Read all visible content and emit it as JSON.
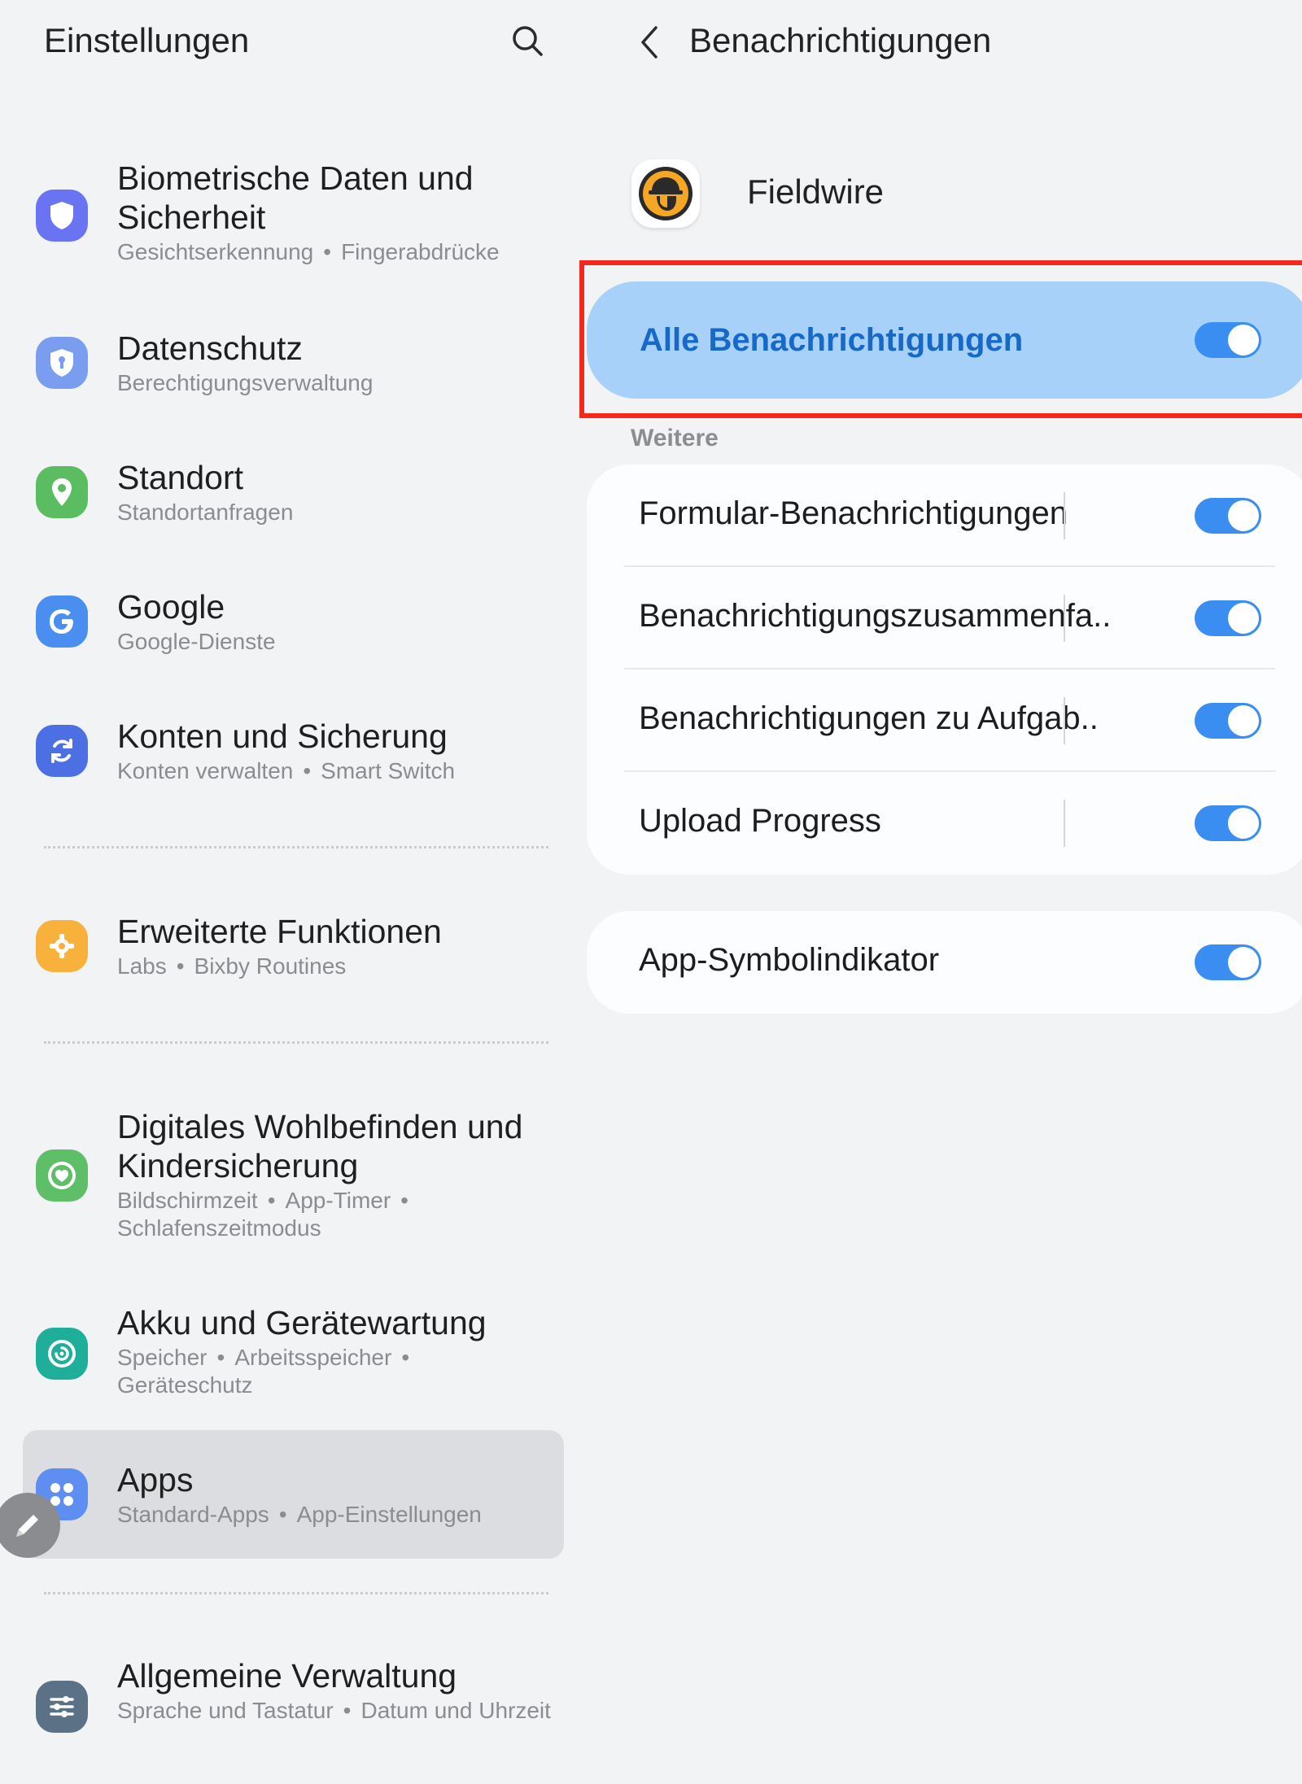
{
  "colors": {
    "background": "#f1f3f5",
    "accent": "#3a8ef2",
    "highlight_card": "#a8d1fa",
    "highlight_text": "#1769c8",
    "annotation_red": "#f5281c",
    "selected_row": "#dcdde0"
  },
  "left": {
    "title": "Einstellungen",
    "search_icon": "search-icon",
    "items": [
      {
        "id": "biometrics",
        "title": "Biometrische Daten und Sicherheit",
        "subs": [
          "Gesichtserkennung",
          "Fingerabdrücke"
        ],
        "icon": "shield-icon",
        "color": "#6a73f2"
      },
      {
        "id": "privacy",
        "title": "Datenschutz",
        "subs": [
          "Berechtigungsverwaltung"
        ],
        "icon": "privacy-shield-icon",
        "color": "#7a9df0"
      },
      {
        "id": "location",
        "title": "Standort",
        "subs": [
          "Standortanfragen"
        ],
        "icon": "location-pin-icon",
        "color": "#5bbd62"
      },
      {
        "id": "google",
        "title": "Google",
        "subs": [
          "Google-Dienste"
        ],
        "icon": "google-g-icon",
        "color": "#4a8ef0"
      },
      {
        "id": "accounts",
        "title": "Konten und Sicherung",
        "subs": [
          "Konten verwalten",
          "Smart Switch"
        ],
        "icon": "sync-icon",
        "color": "#4c6fe3"
      },
      {
        "id": "advanced",
        "title": "Erweiterte Funktionen",
        "subs": [
          "Labs",
          "Bixby Routines"
        ],
        "icon": "puzzle-gear-icon",
        "color": "#f8b23c"
      },
      {
        "id": "wellbeing",
        "title": "Digitales Wohlbefinden und Kindersicherung",
        "subs": [
          "Bildschirmzeit",
          "App-Timer",
          "Schlafenszeitmodus"
        ],
        "icon": "heart-circle-icon",
        "color": "#5fbf69"
      },
      {
        "id": "battery",
        "title": "Akku und Gerätewartung",
        "subs": [
          "Speicher",
          "Arbeitsspeicher",
          "Geräteschutz"
        ],
        "icon": "device-care-icon",
        "color": "#1eae99"
      },
      {
        "id": "apps",
        "title": "Apps",
        "subs": [
          "Standard-Apps",
          "App-Einstellungen"
        ],
        "icon": "apps-grid-icon",
        "color": "#5e8ef2"
      },
      {
        "id": "general",
        "title": "Allgemeine Verwaltung",
        "subs": [
          "Sprache und Tastatur",
          "Datum und Uhrzeit"
        ],
        "icon": "sliders-icon",
        "color": "#5b7186"
      }
    ]
  },
  "right": {
    "back_icon": "chevron-left-icon",
    "title": "Benachrichtigungen",
    "app": {
      "name": "Fieldwire",
      "icon": "fieldwire-logo-icon"
    },
    "all_notifications": {
      "label": "Alle Benachrichtigungen",
      "on": true
    },
    "section_label": "Weitere",
    "categories": [
      {
        "label": "Formular-Benachrichtigungen",
        "on": true
      },
      {
        "label": "Benachrichtigungszusammenfa..",
        "on": true
      },
      {
        "label": "Benachrichtigungen zu Aufgab..",
        "on": true
      },
      {
        "label": "Upload Progress",
        "on": true
      }
    ],
    "badge": {
      "label": "App-Symbolindikator",
      "on": true
    }
  }
}
